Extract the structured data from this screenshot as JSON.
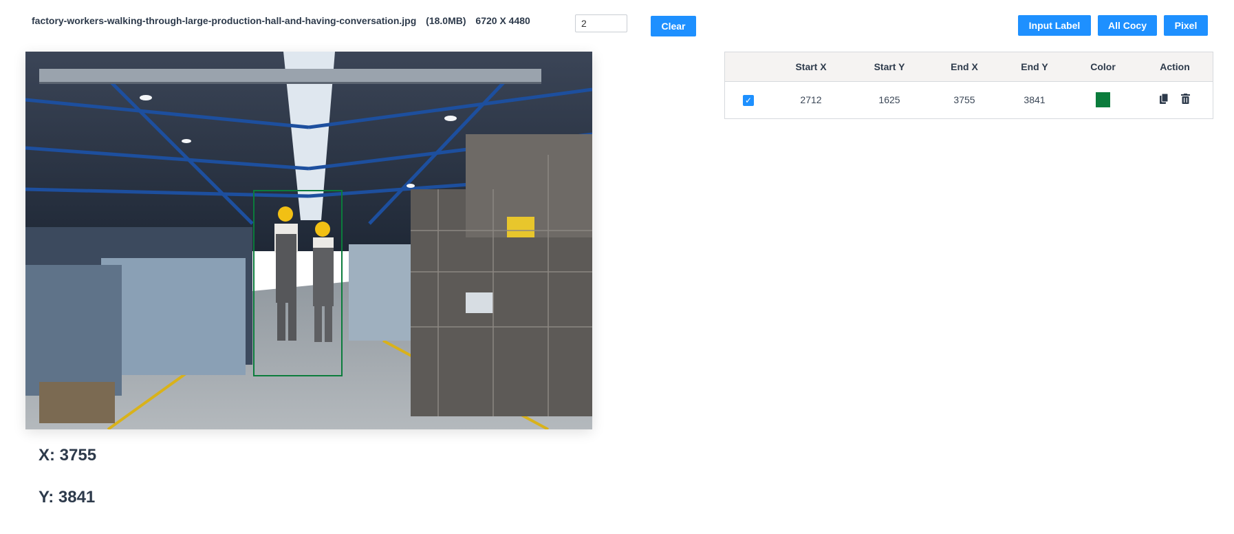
{
  "file": {
    "name": "factory-workers-walking-through-large-production-hall-and-having-conversation.jpg",
    "size": "(18.0MB)",
    "dimensions": "6720 X 4480"
  },
  "controls": {
    "number_value": "2",
    "clear_label": "Clear",
    "input_label_label": "Input Label",
    "all_cocy_label": "All Cocy",
    "pixel_label": "Pixel"
  },
  "coords": {
    "x_text": "X: 3755",
    "y_text": "Y: 3841"
  },
  "table": {
    "headers": [
      "",
      "Start X",
      "Start Y",
      "End X",
      "End Y",
      "Color",
      "Action"
    ],
    "rows": [
      {
        "checked": true,
        "start_x": "2712",
        "start_y": "1625",
        "end_x": "3755",
        "end_y": "3841",
        "color": "#0b7c3c",
        "actions": [
          "copy-icon",
          "trash-icon"
        ]
      }
    ]
  },
  "colors": {
    "accent": "#1e90ff",
    "box_color": "#0b7c3c"
  }
}
